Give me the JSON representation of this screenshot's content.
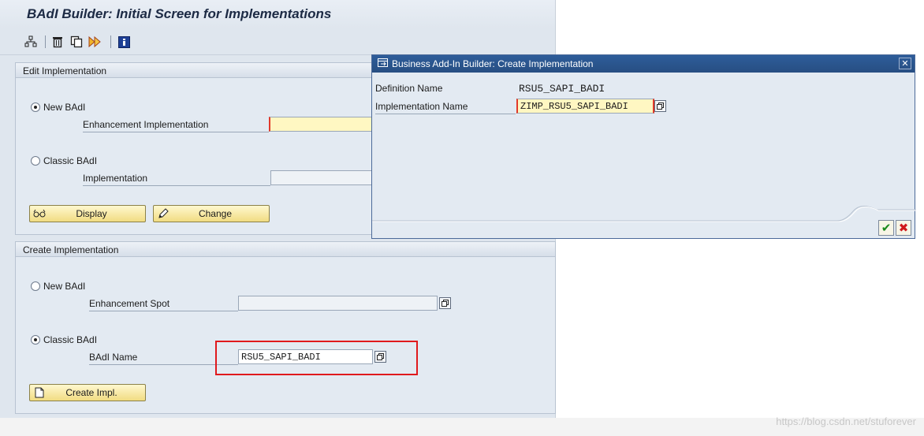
{
  "main": {
    "title": "BAdI Builder: Initial Screen for Implementations",
    "edit_group": {
      "title": "Edit Implementation",
      "new_badi_label": "New BAdI",
      "enh_impl_label": "Enhancement Implementation",
      "enh_impl_value": "",
      "classic_badi_label": "Classic BAdI",
      "impl_label": "Implementation",
      "impl_value": "",
      "display_label": "Display",
      "change_label": "Change"
    },
    "create_group": {
      "title": "Create Implementation",
      "new_badi_label": "New BAdI",
      "enh_spot_label": "Enhancement Spot",
      "enh_spot_value": "",
      "classic_badi_label": "Classic BAdI",
      "badi_name_label": "BAdI Name",
      "badi_name_value": "RSU5_SAPI_BADI",
      "create_label": "Create Impl."
    }
  },
  "dialog": {
    "title": "Business Add-In Builder: Create Implementation",
    "def_name_label": "Definition Name",
    "def_name_value": "RSU5_SAPI_BADI",
    "impl_name_label": "Implementation Name",
    "impl_name_value": "ZIMP_RSU5_SAPI_BADI"
  },
  "icons": {
    "toolbar": [
      "hierarchy-icon",
      "delete-icon",
      "copy-icon",
      "execute-icon",
      "info-icon"
    ]
  },
  "colors": {
    "highlight": "#e0191d",
    "title_bar": "#2e5d9a",
    "required_field": "#fff7c2"
  },
  "watermark": "https://blog.csdn.net/stuforever"
}
